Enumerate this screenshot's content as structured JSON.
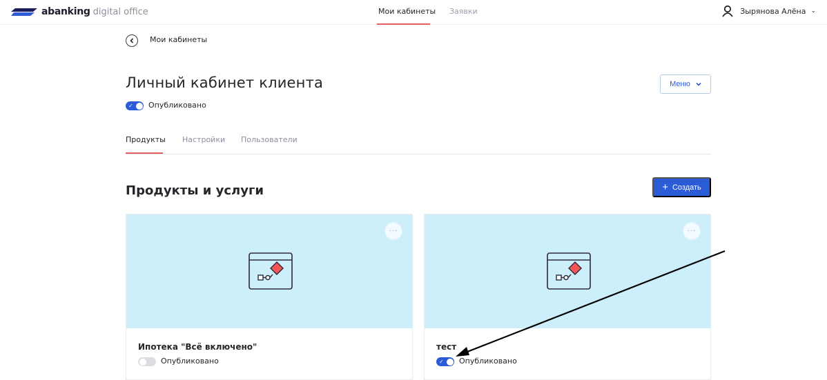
{
  "header": {
    "brand": "abanking",
    "brand_sub": "digital office",
    "nav": [
      {
        "label": "Мои кабинеты",
        "active": true
      },
      {
        "label": "Заявки",
        "active": false
      }
    ],
    "user_name": "Зырянова Алёна"
  },
  "breadcrumb": {
    "back_label": "Мои кабинеты"
  },
  "page": {
    "title": "Личный кабинет клиента",
    "published_label": "Опубликовано",
    "published": true,
    "menu_label": "Меню"
  },
  "tabs": [
    {
      "label": "Продукты",
      "active": true
    },
    {
      "label": "Настройки",
      "active": false
    },
    {
      "label": "Пользователи",
      "active": false
    }
  ],
  "section": {
    "title": "Продукты и услуги",
    "create_label": "Создать"
  },
  "cards": [
    {
      "name": "Ипотека \"Всё включено\"",
      "published_label": "Опубликовано",
      "published": false
    },
    {
      "name": "тест",
      "published_label": "Опубликовано",
      "published": true
    }
  ],
  "colors": {
    "accent": "#2b5bd6",
    "active_underline": "#e45e5e",
    "card_cover": "#cdeefb",
    "illustration_diamond": "#f25555"
  },
  "icons": [
    "logo-mark",
    "user-icon",
    "chevron-down-icon",
    "back-arrow-icon",
    "check-icon",
    "plus-icon",
    "more-icon",
    "process-illustration-icon"
  ]
}
